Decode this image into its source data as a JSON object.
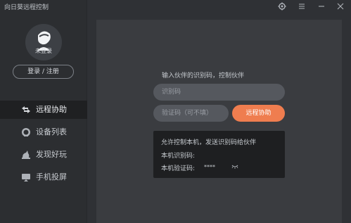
{
  "app": {
    "title": "向日葵远程控制"
  },
  "titlebar": {
    "icons": [
      "gear-icon",
      "menu-icon",
      "minimize-icon",
      "close-icon"
    ]
  },
  "user": {
    "avatar_label": "未登录",
    "login_label": "登录 / 注册"
  },
  "sidebar": {
    "items": [
      {
        "label": "远程协助",
        "icon": "remote-assist-icon",
        "active": true
      },
      {
        "label": "设备列表",
        "icon": "device-list-icon",
        "active": false
      },
      {
        "label": "发现好玩",
        "icon": "discover-icon",
        "active": false
      },
      {
        "label": "手机投屏",
        "icon": "screen-cast-icon",
        "active": false
      }
    ]
  },
  "main": {
    "prompt": "输入伙伴的识别码，控制伙伴",
    "id_placeholder": "识别码",
    "code_placeholder": "验证码（可不填）",
    "connect_label": "远程协助",
    "info": {
      "allow_text": "允许控制本机，发送识别码给伙伴",
      "local_id_label": "本机识别码:",
      "local_code_label": "本机验证码:",
      "local_code_value": "****"
    }
  },
  "colors": {
    "accent": "#ef7d4f",
    "sidebar_bg": "#2c2e31",
    "panel_bg": "#3a3c40",
    "input_bg": "#55585e",
    "info_bg": "#1e1f21"
  }
}
